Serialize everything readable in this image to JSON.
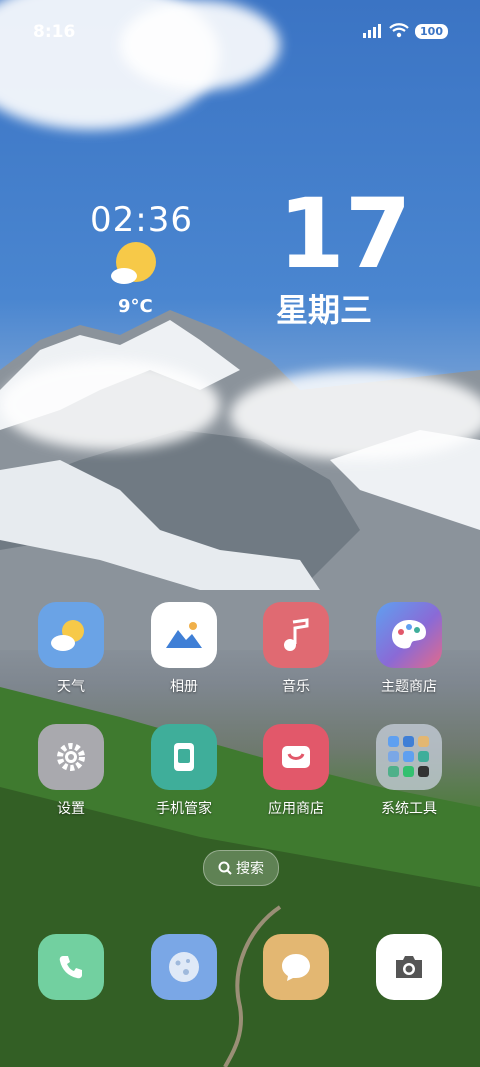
{
  "status": {
    "time": "8:16",
    "battery": "100"
  },
  "widgets": {
    "clock": "02:36",
    "temperature": "9°C",
    "date": "17",
    "weekday": "星期三"
  },
  "apps": [
    {
      "label": "天气",
      "color": "#6aa3e6"
    },
    {
      "label": "相册",
      "color": "#ffffff"
    },
    {
      "label": "音乐",
      "color": "#e06a72"
    },
    {
      "label": "主题商店",
      "color": "#8a6ad6"
    },
    {
      "label": "设置",
      "color": "#a9a9ae"
    },
    {
      "label": "手机管家",
      "color": "#3fae9a"
    },
    {
      "label": "应用商店",
      "color": "#e2586a"
    },
    {
      "label": "系统工具",
      "color": "#b9c2d0"
    }
  ],
  "search": {
    "label": "搜索"
  },
  "dock": [
    {
      "name": "phone",
      "color": "#72d0a0"
    },
    {
      "name": "browser",
      "color": "#7aa7e6"
    },
    {
      "name": "messages",
      "color": "#e3b772"
    },
    {
      "name": "camera",
      "color": "#ffffff"
    }
  ]
}
